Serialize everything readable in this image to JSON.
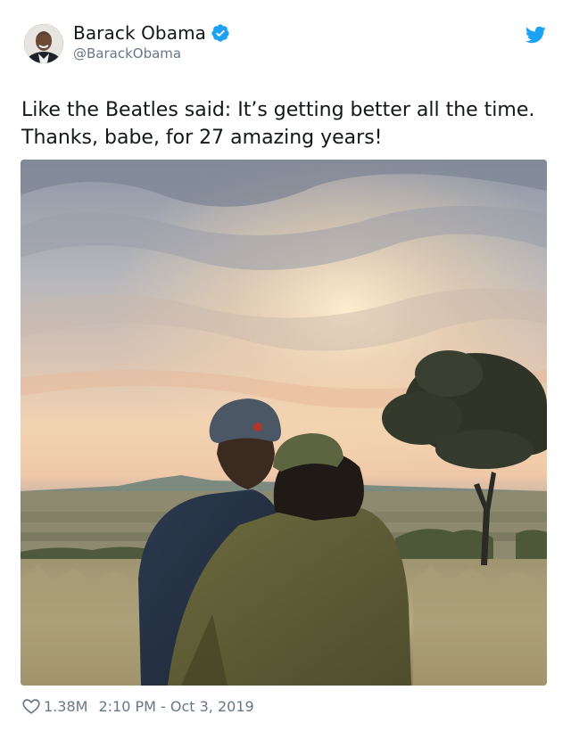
{
  "author": {
    "display_name": "Barack Obama",
    "handle": "@BarackObama",
    "verified": true
  },
  "tweet": {
    "text_lines": [
      "Like the Beatles said: It’s getting better all the time.",
      "Thanks, babe, for 27 amazing years!"
    ]
  },
  "stats": {
    "likes": "1.38M",
    "timestamp": "2:10 PM - Oct 3, 2019"
  },
  "colors": {
    "verified": "#1da1f2",
    "twitter_blue": "#1da1f2",
    "meta_gray": "#657786"
  },
  "icons": {
    "verified": "verified-badge-icon",
    "platform": "twitter-bird-icon",
    "like": "heart-icon"
  }
}
